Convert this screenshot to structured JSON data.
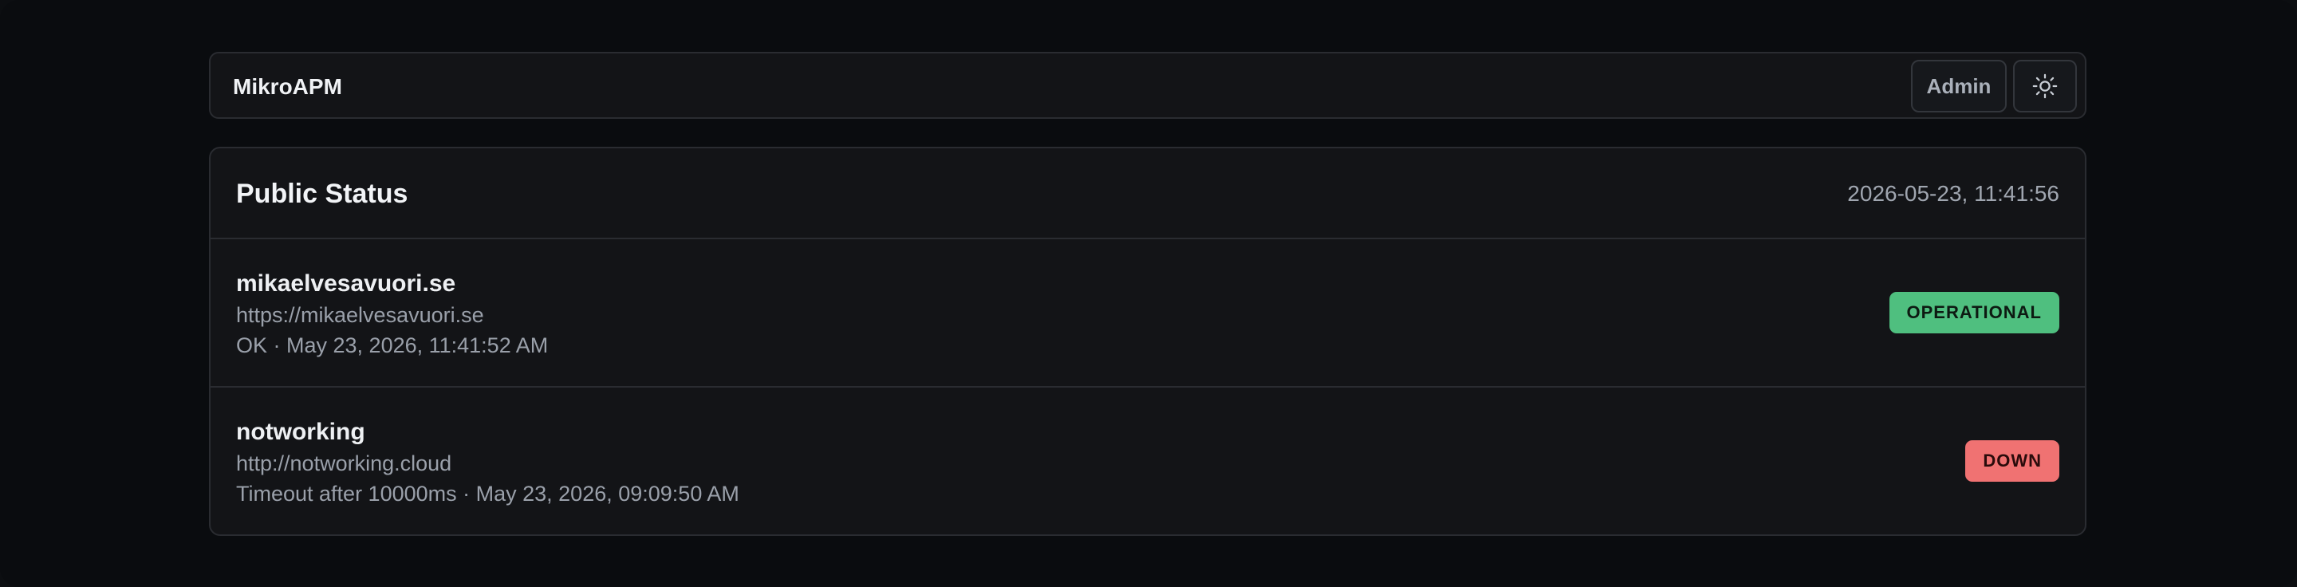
{
  "navbar": {
    "brand": "MikroAPM",
    "admin_label": "Admin",
    "theme_icon": "sun-icon"
  },
  "status": {
    "title": "Public Status",
    "timestamp": "2026-05-23, 11:41:56",
    "monitors": [
      {
        "name": "mikaelvesavuori.se",
        "url": "https://mikaelvesavuori.se",
        "detail": "OK · May 23, 2026, 11:41:52 AM",
        "badge": "OPERATIONAL",
        "badge_color": "#4fbf7f"
      },
      {
        "name": "notworking",
        "url": "http://notworking.cloud",
        "detail": "Timeout after 10000ms · May 23, 2026, 09:09:50 AM",
        "badge": "DOWN",
        "badge_color": "#f07272"
      }
    ]
  }
}
